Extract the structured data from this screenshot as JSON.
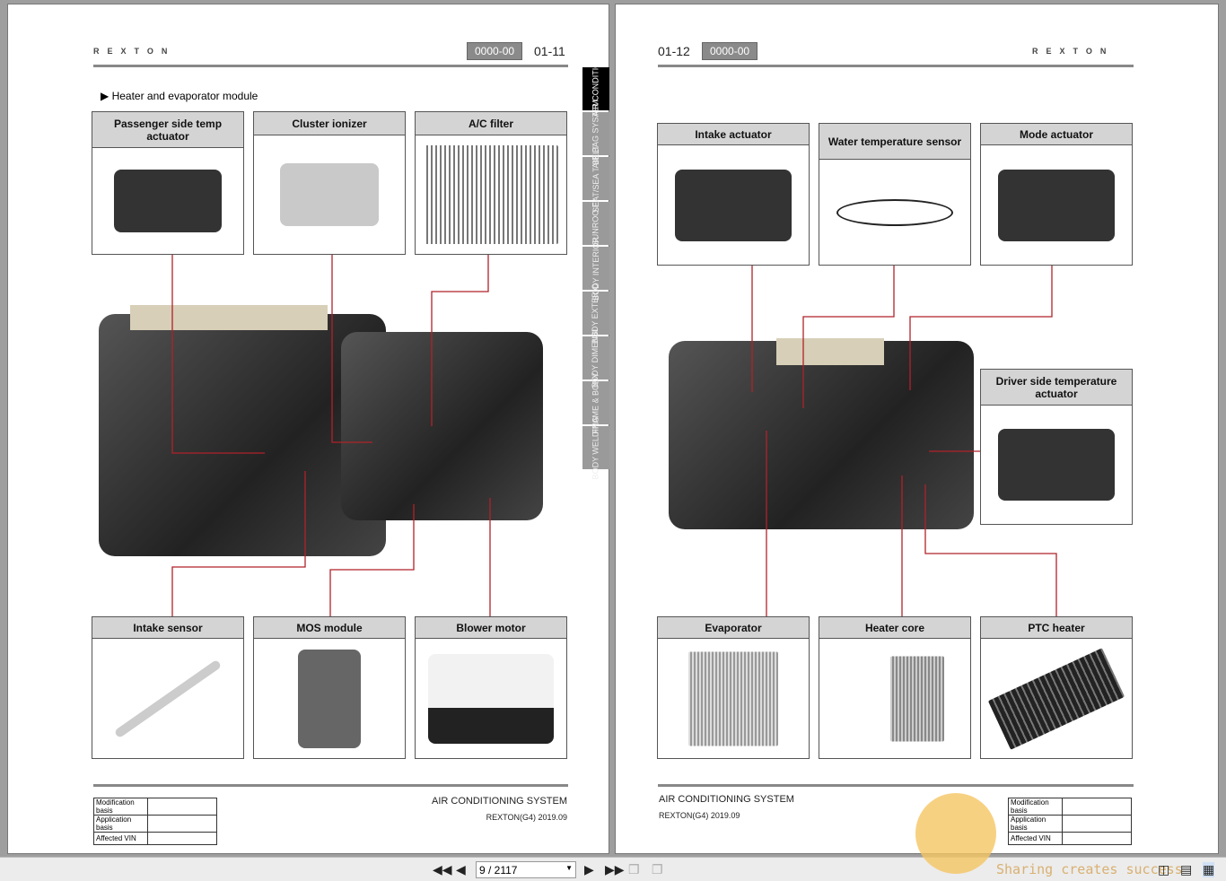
{
  "left_page": {
    "logo": "REXTON",
    "badge": "0000-00",
    "page_number": "01-11",
    "section_title": "Heater and evaporator module",
    "top_components": [
      "Passenger side temp actuator",
      "Cluster ionizer",
      "A/C filter"
    ],
    "bottom_components": [
      "Intake sensor",
      "MOS module",
      "Blower motor"
    ],
    "tabs": [
      "AIR CONDITIO",
      "AIR BAG SYSTEM",
      "SEAT/SEA T BELT",
      "SUNROO F",
      "BODY INTERIOR",
      "BODY EXTERIO",
      "BODY DIMENSI",
      "FRAME & BODY",
      "BODY WELDING"
    ],
    "footer_title": "AIR CONDITIONING SYSTEM",
    "footer_model": "REXTON(G4) 2019.09",
    "meta_rows": [
      "Modification basis",
      "Application basis",
      "Affected VIN"
    ]
  },
  "right_page": {
    "logo": "REXTON",
    "badge": "0000-00",
    "page_number": "01-12",
    "top_components": [
      "Intake actuator",
      "Water temperature sensor",
      "Mode actuator"
    ],
    "side_component": "Driver side temperature actuator",
    "bottom_components": [
      "Evaporator",
      "Heater core",
      "PTC heater"
    ],
    "footer_title": "AIR CONDITIONING SYSTEM",
    "footer_model": "REXTON(G4) 2019.09",
    "meta_rows": [
      "Modification basis",
      "Application basis",
      "Affected VIN"
    ]
  },
  "toolbar": {
    "page_indicator": "9 / 2117",
    "watermark_text": "Sharing creates success"
  },
  "colors": {
    "leader_line": "#b0222a",
    "active_tab": "#000000",
    "tab": "#9a9a9a"
  }
}
